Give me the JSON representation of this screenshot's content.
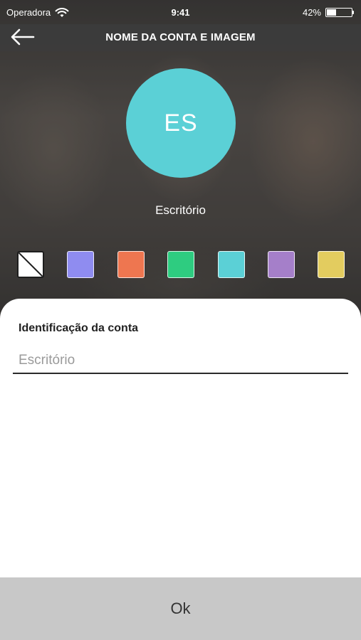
{
  "status_bar": {
    "carrier": "Operadora",
    "time": "9:41",
    "battery_percent_label": "42%",
    "battery_level": 0.42
  },
  "nav": {
    "title": "NOME DA CONTA E IMAGEM",
    "back_icon": "arrow-left-icon"
  },
  "avatar": {
    "initials": "ES",
    "color": "#5bd0d6"
  },
  "account_name": "Escritório",
  "color_options": [
    {
      "name": "none",
      "color": "#ffffff"
    },
    {
      "name": "blue",
      "color": "#8f8cf0"
    },
    {
      "name": "orange",
      "color": "#ee7650"
    },
    {
      "name": "green",
      "color": "#2ecc80"
    },
    {
      "name": "cyan",
      "color": "#5bd0d6"
    },
    {
      "name": "purple",
      "color": "#a57fc9"
    },
    {
      "name": "yellow",
      "color": "#e3cc5f"
    }
  ],
  "form": {
    "label": "Identificação da conta",
    "value": "",
    "placeholder": "Escritório"
  },
  "ok_label": "Ok"
}
